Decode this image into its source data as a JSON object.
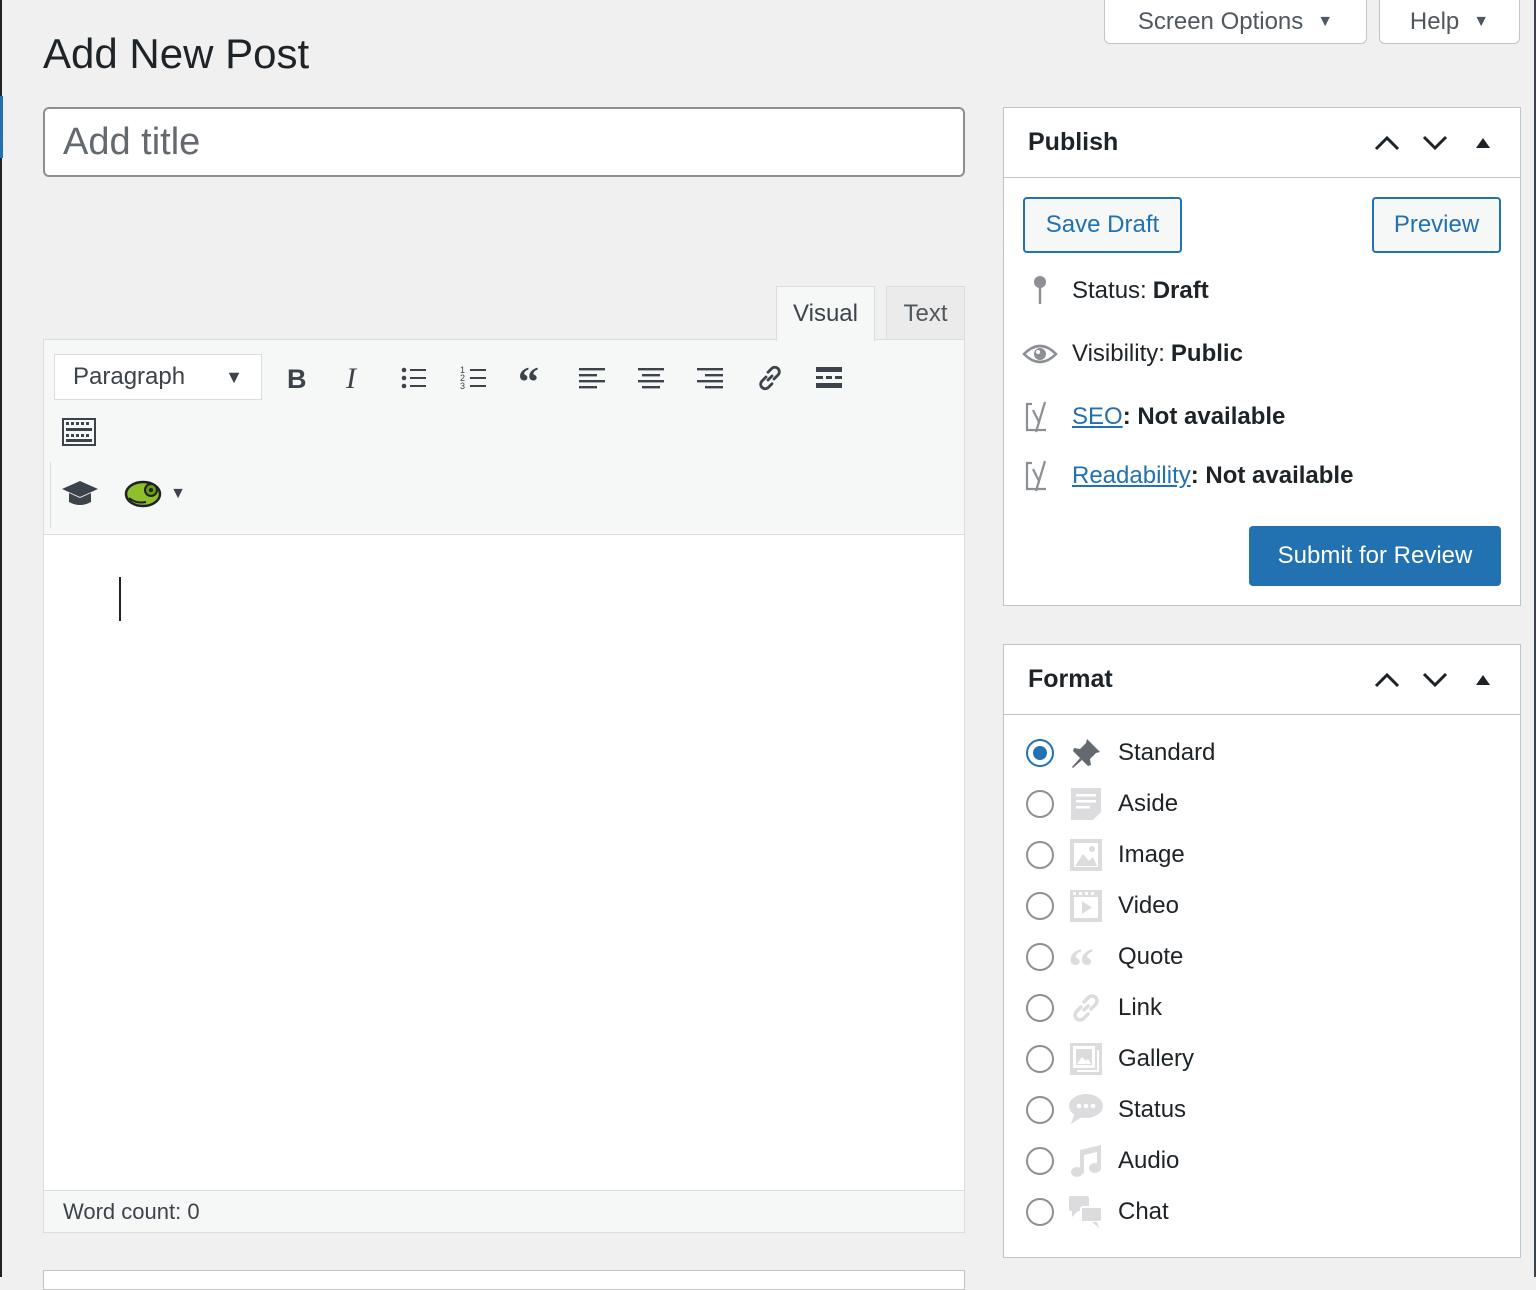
{
  "page": {
    "title": "Add New Post"
  },
  "top_buttons": {
    "screen_options": "Screen Options",
    "help": "Help"
  },
  "title_field": {
    "placeholder": "Add title",
    "value": ""
  },
  "editor": {
    "tabs": {
      "visual": "Visual",
      "text": "Text"
    },
    "format_select": "Paragraph",
    "word_count": "Word count: 0"
  },
  "publish": {
    "title": "Publish",
    "save_draft": "Save Draft",
    "preview": "Preview",
    "status_label": "Status:",
    "status_value": "Draft",
    "visibility_label": "Visibility:",
    "visibility_value": "Public",
    "seo_link": "SEO",
    "seo_value": ": Not available",
    "readability_link": "Readability",
    "readability_value": ": Not available",
    "submit": "Submit for Review"
  },
  "format_box": {
    "title": "Format",
    "selected": "Standard",
    "options": [
      "Standard",
      "Aside",
      "Image",
      "Video",
      "Quote",
      "Link",
      "Gallery",
      "Status",
      "Audio",
      "Chat"
    ]
  },
  "colors": {
    "accent": "#2271b1",
    "background": "#f0f0f1"
  }
}
